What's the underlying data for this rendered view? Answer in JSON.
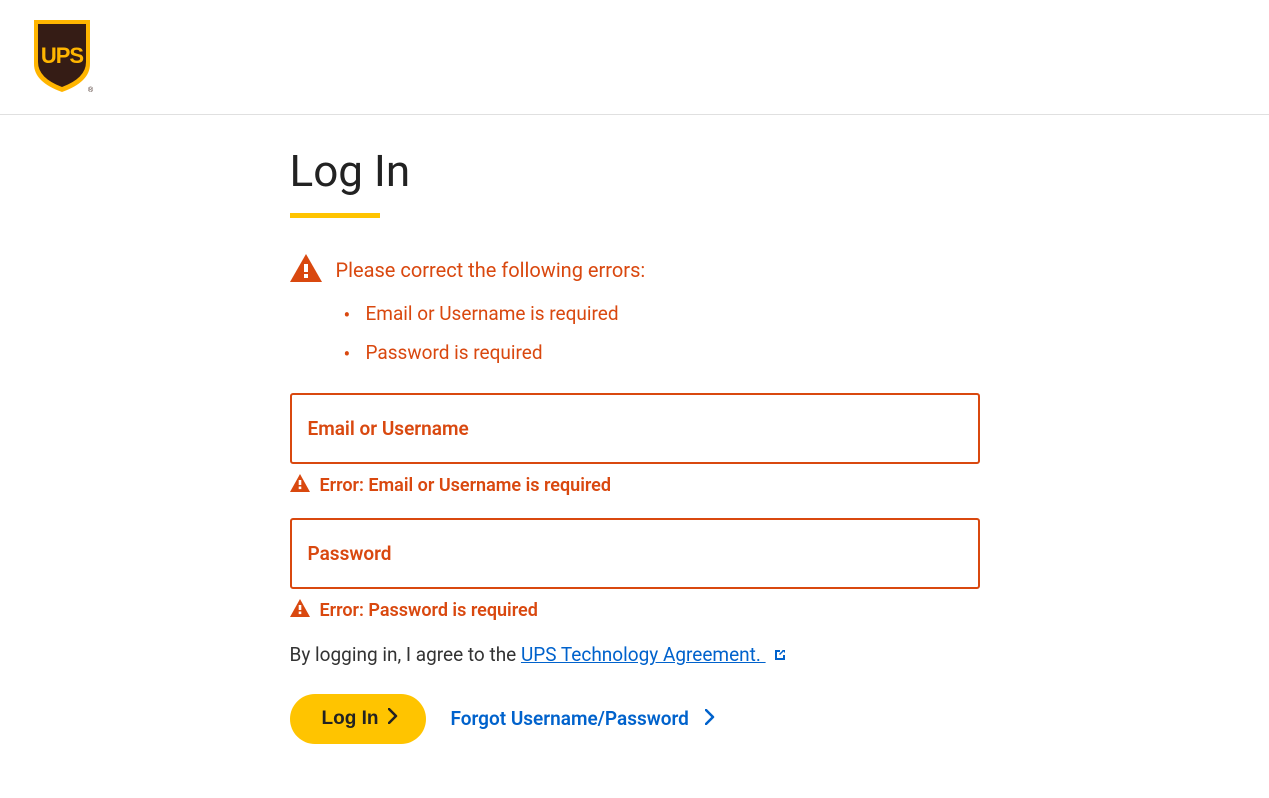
{
  "page": {
    "title": "Log In"
  },
  "errors": {
    "summary_title": "Please correct the following errors:",
    "items": [
      "Email or Username is required",
      "Password is required"
    ]
  },
  "form": {
    "email": {
      "label": "Email or Username",
      "error": "Error: Email or Username is required"
    },
    "password": {
      "label": "Password",
      "error": "Error: Password is required"
    }
  },
  "agreement": {
    "prefix": "By logging in, I agree to the ",
    "link_text": "UPS Technology Agreement. "
  },
  "actions": {
    "login": "Log In",
    "forgot": "Forgot Username/Password"
  }
}
